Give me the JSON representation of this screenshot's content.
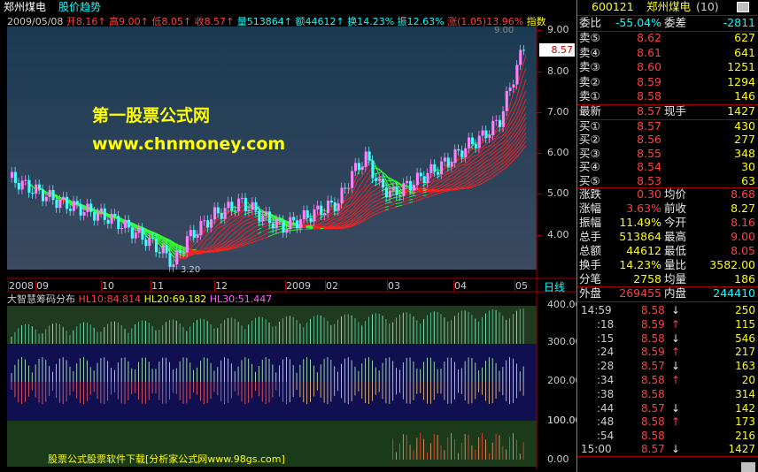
{
  "title_bar": {
    "stock_name": "郑州煤电",
    "view_name": "股价趋势"
  },
  "info_line": {
    "date": "2009/05/08",
    "open_label": "开",
    "open": "8.16",
    "high_label": "高",
    "high": "9.00",
    "low_label": "低",
    "low": "8.05",
    "close_label": "收",
    "close": "8.57",
    "volume_label": "量",
    "volume": "513864",
    "amount_label": "额",
    "amount": "44612",
    "turnover_label": "换",
    "turnover": "14.23%",
    "amplitude_label": "振",
    "amplitude": "12.63%",
    "change_label": "涨",
    "change": "(1.05)13.96%",
    "index_button": "指数"
  },
  "watermark": {
    "line1": "第一股票公式网",
    "line2": "www.chnmoney.com"
  },
  "price_axis": {
    "ticks": [
      "9.00",
      "8.00",
      "7.00",
      "6.00",
      "5.00",
      "4.00"
    ],
    "current_price": "8.57",
    "high_mark": "9.00",
    "low_mark": "3.20"
  },
  "date_axis": {
    "labels": [
      "2008",
      "09",
      "10",
      "11",
      "12",
      "2009",
      "02",
      "03",
      "04",
      "05"
    ],
    "period": "日线"
  },
  "indicator": {
    "name": "大智慧筹码分布",
    "hl10": "HL10:84.814",
    "hl20": "HL20:69.182",
    "hl30": "HL30:51.447"
  },
  "sub_axes": [
    {
      "ticks": [
        "400.00",
        "300.00"
      ]
    },
    {
      "ticks": [
        "200.00",
        "100.00"
      ]
    },
    {
      "ticks": [
        "100.00",
        "0.00"
      ]
    }
  ],
  "footer_watermark": "股票公式股票软件下载[分析家公式网www.98gs.com]",
  "quote": {
    "code": "600121",
    "name": "郑州煤电",
    "tag": "(10)",
    "weibi_label": "委比",
    "weibi": "-55.04%",
    "weicha_label": "委差",
    "weicha": "-2811",
    "asks": [
      {
        "label": "卖⑤",
        "price": "8.62",
        "vol": "627"
      },
      {
        "label": "卖④",
        "price": "8.61",
        "vol": "641"
      },
      {
        "label": "卖③",
        "price": "8.60",
        "vol": "1251"
      },
      {
        "label": "卖②",
        "price": "8.59",
        "vol": "1294"
      },
      {
        "label": "卖①",
        "price": "8.58",
        "vol": "146"
      }
    ],
    "last_label": "最新",
    "last": "8.57",
    "cur_label": "现手",
    "cur": "1427",
    "bids": [
      {
        "label": "买①",
        "price": "8.57",
        "vol": "430"
      },
      {
        "label": "买②",
        "price": "8.56",
        "vol": "277"
      },
      {
        "label": "买③",
        "price": "8.55",
        "vol": "348"
      },
      {
        "label": "买④",
        "price": "8.54",
        "vol": "30"
      },
      {
        "label": "买⑤",
        "price": "8.53",
        "vol": "63"
      }
    ],
    "stats": [
      {
        "l1": "涨跌",
        "v1": "0.30",
        "l2": "均价",
        "v2": "8.68"
      },
      {
        "l1": "涨幅",
        "v1": "3.63%",
        "l2": "前收",
        "v2": "8.27"
      },
      {
        "l1": "振幅",
        "v1": "11.49%",
        "l2": "今开",
        "v2": "8.16"
      },
      {
        "l1": "总手",
        "v1": "513864",
        "l2": "最高",
        "v2": "9.00"
      },
      {
        "l1": "总额",
        "v1": "44612",
        "l2": "最低",
        "v2": "8.05"
      },
      {
        "l1": "换手",
        "v1": "14.23%",
        "l2": "量比",
        "v2": "3582.00"
      },
      {
        "l1": "分笔",
        "v1": "2758",
        "l2": "均量",
        "v2": "186"
      }
    ],
    "outer_label": "外盘",
    "outer": "269455",
    "inner_label": "内盘",
    "inner": "244410"
  },
  "ticks": [
    {
      "time": "14:59",
      "price": "8.58",
      "dir": "↓",
      "vol": "250"
    },
    {
      "time": ":18",
      "price": "8.59",
      "dir": "↑",
      "vol": "115"
    },
    {
      "time": ":15",
      "price": "8.58",
      "dir": "↓",
      "vol": "546"
    },
    {
      "time": ":24",
      "price": "8.59",
      "dir": "↑",
      "vol": "217"
    },
    {
      "time": ":28",
      "price": "8.57",
      "dir": "↓",
      "vol": "163"
    },
    {
      "time": ":34",
      "price": "8.58",
      "dir": "↑",
      "vol": "20"
    },
    {
      "time": ":38",
      "price": "8.58",
      "dir": "",
      "vol": "314"
    },
    {
      "time": ":44",
      "price": "8.57",
      "dir": "↓",
      "vol": "142"
    },
    {
      "time": ":48",
      "price": "8.58",
      "dir": "↑",
      "vol": "173"
    },
    {
      "time": ":54",
      "price": "8.58",
      "dir": "",
      "vol": "216"
    },
    {
      "time": "15:00",
      "price": "8.57",
      "dir": "↓",
      "vol": "1427"
    }
  ],
  "colors": {
    "up": "#ff3030",
    "down": "#00e000",
    "yellow": "#ffff00",
    "cyan": "#00ffff",
    "magenta": "#ff60ff"
  }
}
